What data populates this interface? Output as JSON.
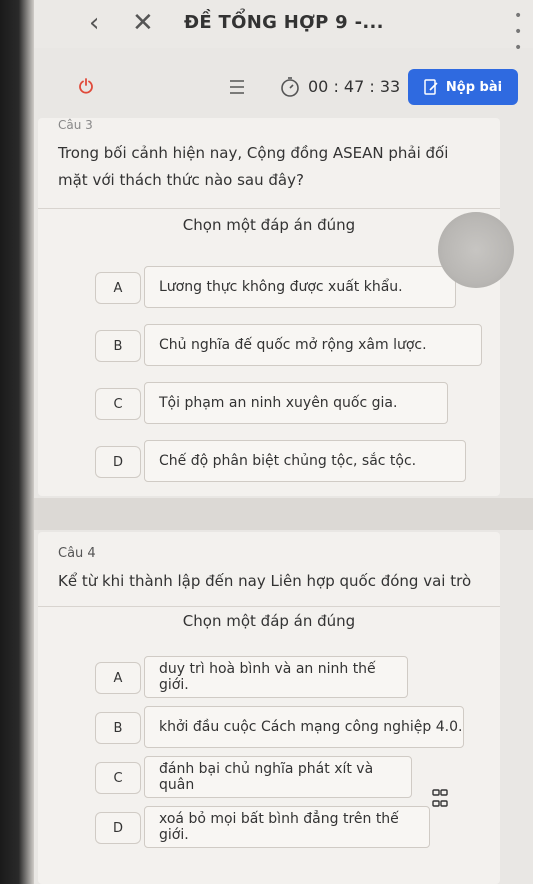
{
  "header": {
    "title": "ĐỀ TỔNG HỢP 9 -...",
    "back_glyph": "‹",
    "close_glyph": "✕",
    "more_glyph": "• • •"
  },
  "toolbar": {
    "timer": "00 : 47 : 33",
    "submit_label": "Nộp bài"
  },
  "question1": {
    "number_partial": "Câu 3",
    "text": "Trong bối cảnh hiện nay, Cộng đồng ASEAN phải đối mặt với thách thức nào sau đây?",
    "prompt": "Chọn một đáp án đúng",
    "options": [
      {
        "letter": "A",
        "text": "Lương thực không được xuất khẩu."
      },
      {
        "letter": "B",
        "text": "Chủ nghĩa đế quốc mở rộng xâm lược."
      },
      {
        "letter": "C",
        "text": "Tội phạm an ninh xuyên quốc gia."
      },
      {
        "letter": "D",
        "text": "Chế độ phân biệt chủng tộc, sắc tộc."
      }
    ]
  },
  "question2": {
    "number": "Câu 4",
    "text": "Kể từ khi thành lập đến nay Liên hợp quốc đóng vai trò",
    "prompt": "Chọn một đáp án đúng",
    "options": [
      {
        "letter": "A",
        "text": "duy trì hoà bình và an ninh thế giới."
      },
      {
        "letter": "B",
        "text": "khởi đầu cuộc Cách mạng công nghiệp 4.0."
      },
      {
        "letter": "C",
        "text": "đánh bại chủ nghĩa phát xít và quân"
      },
      {
        "letter": "D",
        "text": "xoá bỏ mọi bất bình đẳng trên thế giới."
      }
    ]
  }
}
